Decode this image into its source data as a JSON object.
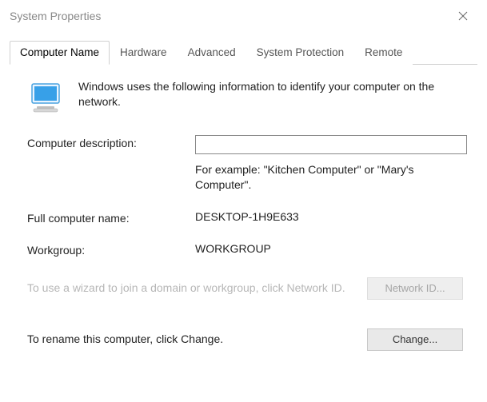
{
  "window": {
    "title": "System Properties"
  },
  "tabs": {
    "computer_name": "Computer Name",
    "hardware": "Hardware",
    "advanced": "Advanced",
    "system_protection": "System Protection",
    "remote": "Remote"
  },
  "intro": {
    "text": "Windows uses the following information to identify your computer on the network."
  },
  "fields": {
    "description_label": "Computer description:",
    "description_value": "",
    "description_example": "For example: \"Kitchen Computer\" or \"Mary's Computer\".",
    "full_name_label": "Full computer name:",
    "full_name_value": "DESKTOP-1H9E633",
    "workgroup_label": "Workgroup:",
    "workgroup_value": "WORKGROUP"
  },
  "actions": {
    "network_id_desc": "To use a wizard to join a domain or workgroup, click Network ID.",
    "network_id_button": "Network ID...",
    "change_desc": "To rename this computer, click Change.",
    "change_button": "Change..."
  }
}
